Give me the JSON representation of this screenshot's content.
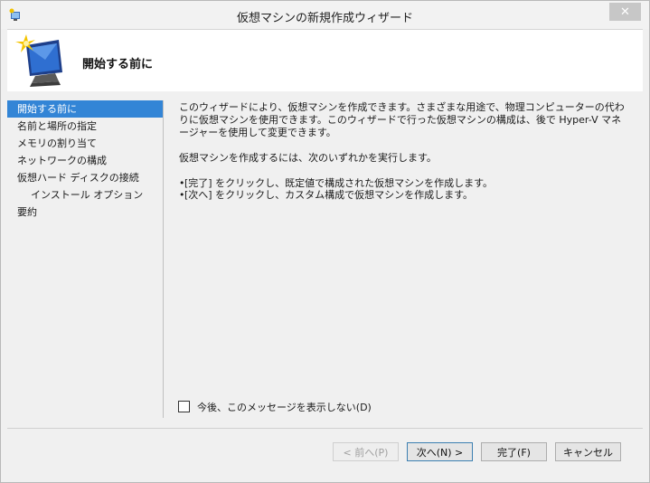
{
  "window": {
    "title": "仮想マシンの新規作成ウィザード",
    "close_label": "✕"
  },
  "header": {
    "title": "開始する前に",
    "icon": "virtual-machine-wizard-icon"
  },
  "nav": {
    "items": [
      {
        "label": "開始する前に",
        "active": true
      },
      {
        "label": "名前と場所の指定"
      },
      {
        "label": "メモリの割り当て"
      },
      {
        "label": "ネットワークの構成"
      },
      {
        "label": "仮想ハード ディスクの接続"
      },
      {
        "label": "インストール オプション",
        "sub": true
      },
      {
        "label": "要約"
      }
    ]
  },
  "content": {
    "paragraph1": "このウィザードにより、仮想マシンを作成できます。さまざまな用途で、物理コンピューターの代わりに仮想マシンを使用できます。このウィザードで行った仮想マシンの構成は、後で Hyper-V マネージャーを使用して変更できます。",
    "paragraph2": "仮想マシンを作成するには、次のいずれかを実行します。",
    "bullet1": "[完了] をクリックし、既定値で構成された仮想マシンを作成します。",
    "bullet2": "[次へ] をクリックし、カスタム構成で仮想マシンを作成します。"
  },
  "checkbox": {
    "label": "今後、このメッセージを表示しない(D)",
    "checked": false
  },
  "buttons": {
    "back": "< 前へ(P)",
    "next": "次へ(N) >",
    "finish": "完了(F)",
    "cancel": "キャンセル"
  },
  "colors": {
    "accent": "#3385d6",
    "header_bg": "#ffffff",
    "body_bg": "#f0f0f0"
  }
}
